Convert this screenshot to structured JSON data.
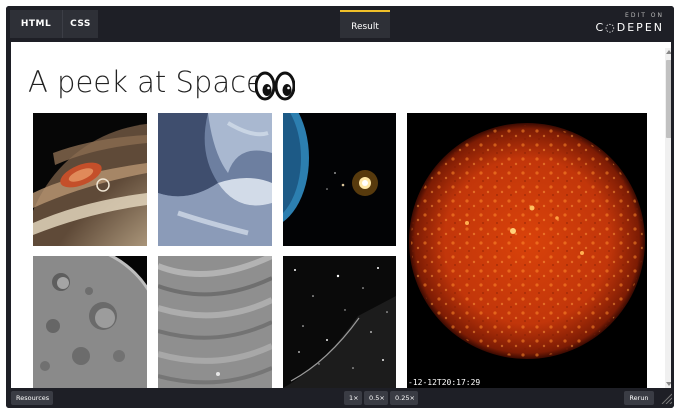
{
  "editor": {
    "tabs": {
      "html": "HTML",
      "css": "CSS",
      "result": "Result"
    },
    "brand": {
      "edit_on": "EDIT ON",
      "name": "C◌DEPEN"
    }
  },
  "page": {
    "title": "A peek at Space",
    "title_emoji_icon": "eyes-emoji-icon",
    "gallery": [
      {
        "name": "jupiter-tile"
      },
      {
        "name": "ice-surface-tile"
      },
      {
        "name": "planet-and-star-tile"
      },
      {
        "name": "sun-tile",
        "caption": "-12-12T20:17:29"
      },
      {
        "name": "moon-craters-tile"
      },
      {
        "name": "grooved-terrain-tile"
      },
      {
        "name": "starfield-tile"
      }
    ]
  },
  "footer": {
    "resources": "Resources",
    "zoom": [
      "1×",
      "0.5×",
      "0.25×"
    ],
    "rerun": "Rerun"
  },
  "colors": {
    "chrome": "#1e1f26",
    "tab": "#2e3037",
    "accent": "#f0c029",
    "button": "#3a3c44"
  }
}
